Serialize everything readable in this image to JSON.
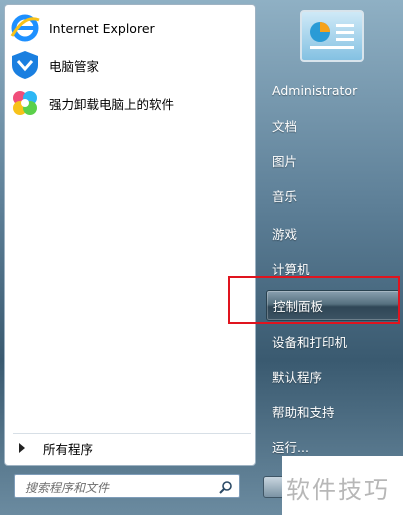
{
  "programs": [
    {
      "label": "Internet Explorer",
      "icon": "internet-explorer-icon"
    },
    {
      "label": "电脑管家",
      "icon": "pc-manager-shield-icon"
    },
    {
      "label": "强力卸载电脑上的软件",
      "icon": "uninstall-flower-icon"
    }
  ],
  "all_programs": "所有程序",
  "search": {
    "placeholder": "搜索程序和文件"
  },
  "right_menu": [
    {
      "label": "Administrator"
    },
    {
      "label": "文档"
    },
    {
      "label": "图片"
    },
    {
      "label": "音乐"
    },
    {
      "label": "游戏"
    },
    {
      "label": "计算机"
    },
    {
      "label": "控制面板"
    },
    {
      "label": "设备和打印机"
    },
    {
      "label": "默认程序"
    },
    {
      "label": "帮助和支持"
    },
    {
      "label": "运行..."
    }
  ],
  "watermark": "软件技巧",
  "colors": {
    "highlight": "#e0141e",
    "accent_blue": "#1b8be0"
  }
}
